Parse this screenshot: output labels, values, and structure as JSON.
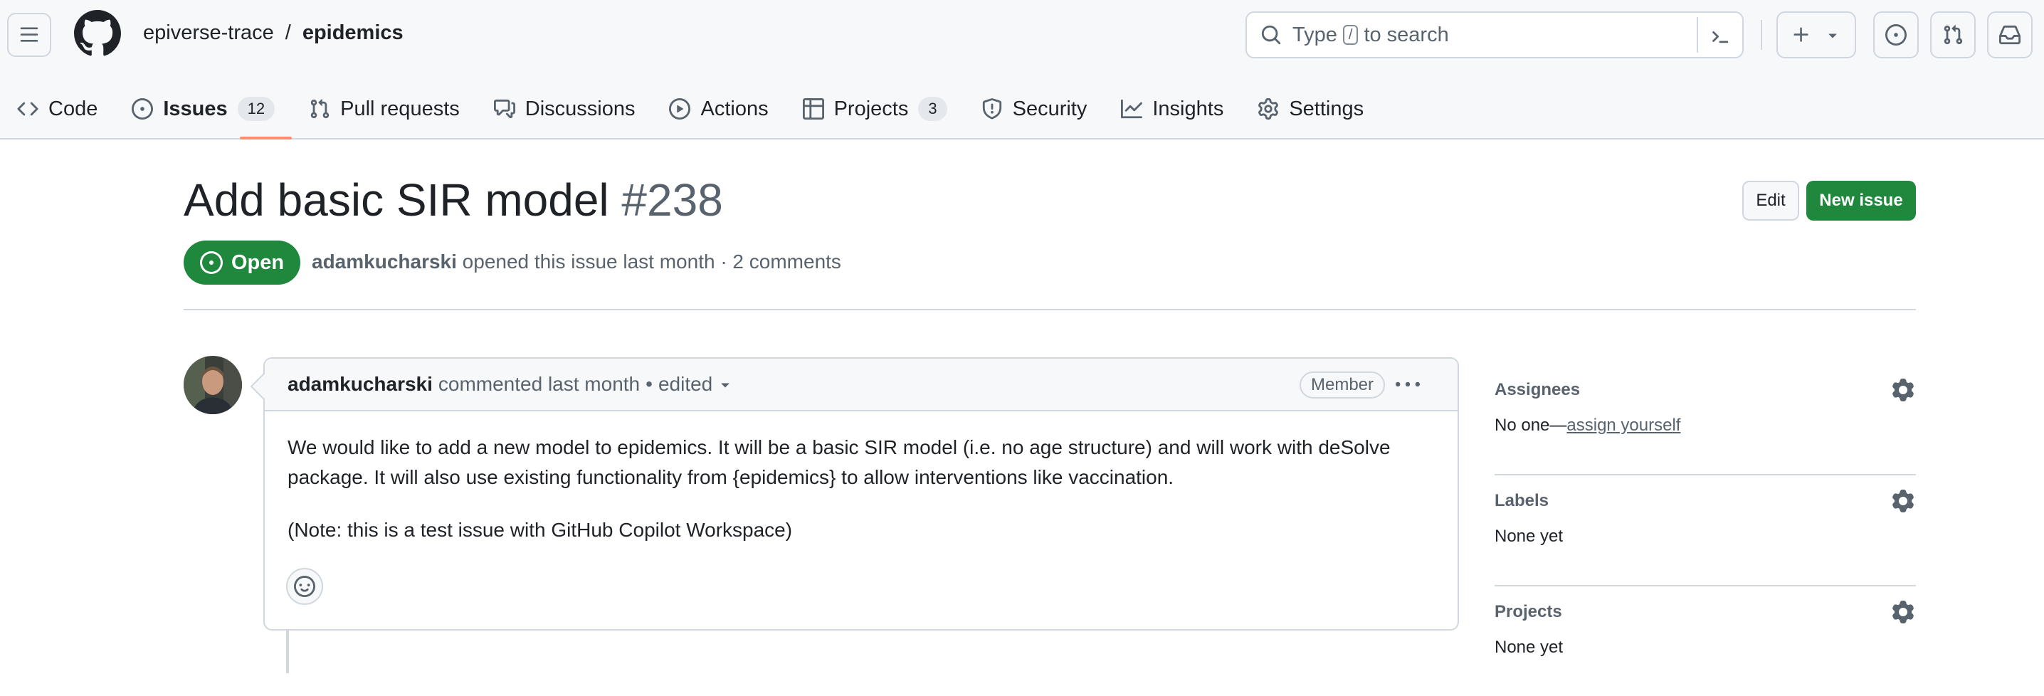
{
  "header": {
    "owner": "epiverse-trace",
    "separator": "/",
    "repo": "epidemics",
    "search": {
      "prefix": "Type",
      "key": "/",
      "suffix": "to search"
    }
  },
  "tabs": [
    {
      "label": "Code",
      "icon": "code-icon"
    },
    {
      "label": "Issues",
      "icon": "issue-opened-icon",
      "count": "12"
    },
    {
      "label": "Pull requests",
      "icon": "git-pull-request-icon"
    },
    {
      "label": "Discussions",
      "icon": "comment-discussion-icon"
    },
    {
      "label": "Actions",
      "icon": "play-icon"
    },
    {
      "label": "Projects",
      "icon": "table-icon",
      "count": "3"
    },
    {
      "label": "Security",
      "icon": "shield-icon"
    },
    {
      "label": "Insights",
      "icon": "graph-icon"
    },
    {
      "label": "Settings",
      "icon": "gear-icon"
    }
  ],
  "issue": {
    "title": "Add basic SIR model",
    "number": "#238",
    "state": "Open",
    "author": "adamkucharski",
    "opened_text": "opened this issue last month · 2 comments",
    "edit_label": "Edit",
    "new_issue_label": "New issue"
  },
  "comment": {
    "author": "adamkucharski",
    "action": "commented last month",
    "bullet": "•",
    "edited": "edited",
    "role": "Member",
    "paragraphs": [
      "We would like to add a new model to epidemics. It will be a basic SIR model (i.e. no age structure) and will work with deSolve package. It will also use existing functionality from {epidemics} to allow interventions like vaccination.",
      "(Note: this is a test issue with GitHub Copilot Workspace)"
    ]
  },
  "sidebar": {
    "assignees": {
      "title": "Assignees",
      "value": "No one—",
      "link": "assign yourself"
    },
    "labels": {
      "title": "Labels",
      "value": "None yet"
    },
    "projects": {
      "title": "Projects",
      "value": "None yet"
    }
  },
  "colors": {
    "accent_green": "#1f883d",
    "tab_underline": "#fd8c73",
    "border": "#d0d7de",
    "muted_text": "#59636e"
  }
}
